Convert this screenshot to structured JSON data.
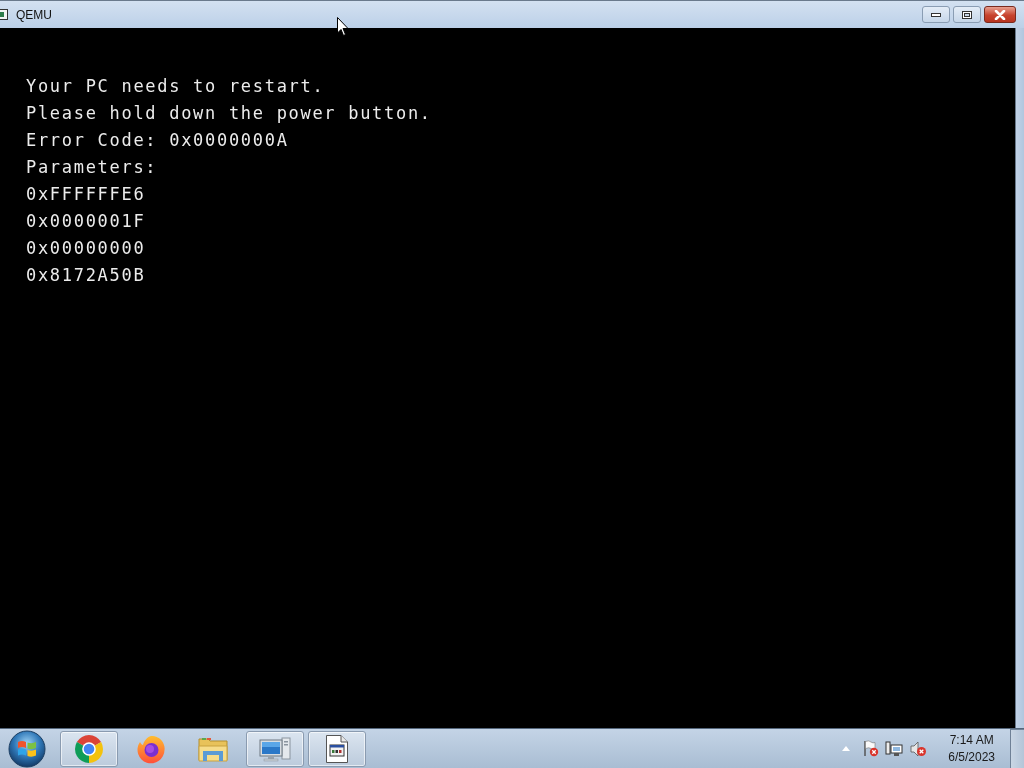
{
  "window": {
    "title": "QEMU"
  },
  "screen": {
    "lines": [
      "Your PC needs to restart.",
      "Please hold down the power button.",
      "Error Code: 0x0000000A",
      "Parameters:",
      "0xFFFFFFE6",
      "0x0000001F",
      "0x00000000",
      "0x8172A50B"
    ]
  },
  "taskbar": {
    "apps": [
      {
        "kind": "ring",
        "running": true
      },
      {
        "kind": "fox",
        "running": false
      },
      {
        "kind": "folder",
        "running": false
      },
      {
        "kind": "monitor",
        "running": true
      },
      {
        "kind": "document",
        "running": true
      }
    ],
    "clock": {
      "time": "7:14 AM",
      "date": "6/5/2023"
    }
  }
}
